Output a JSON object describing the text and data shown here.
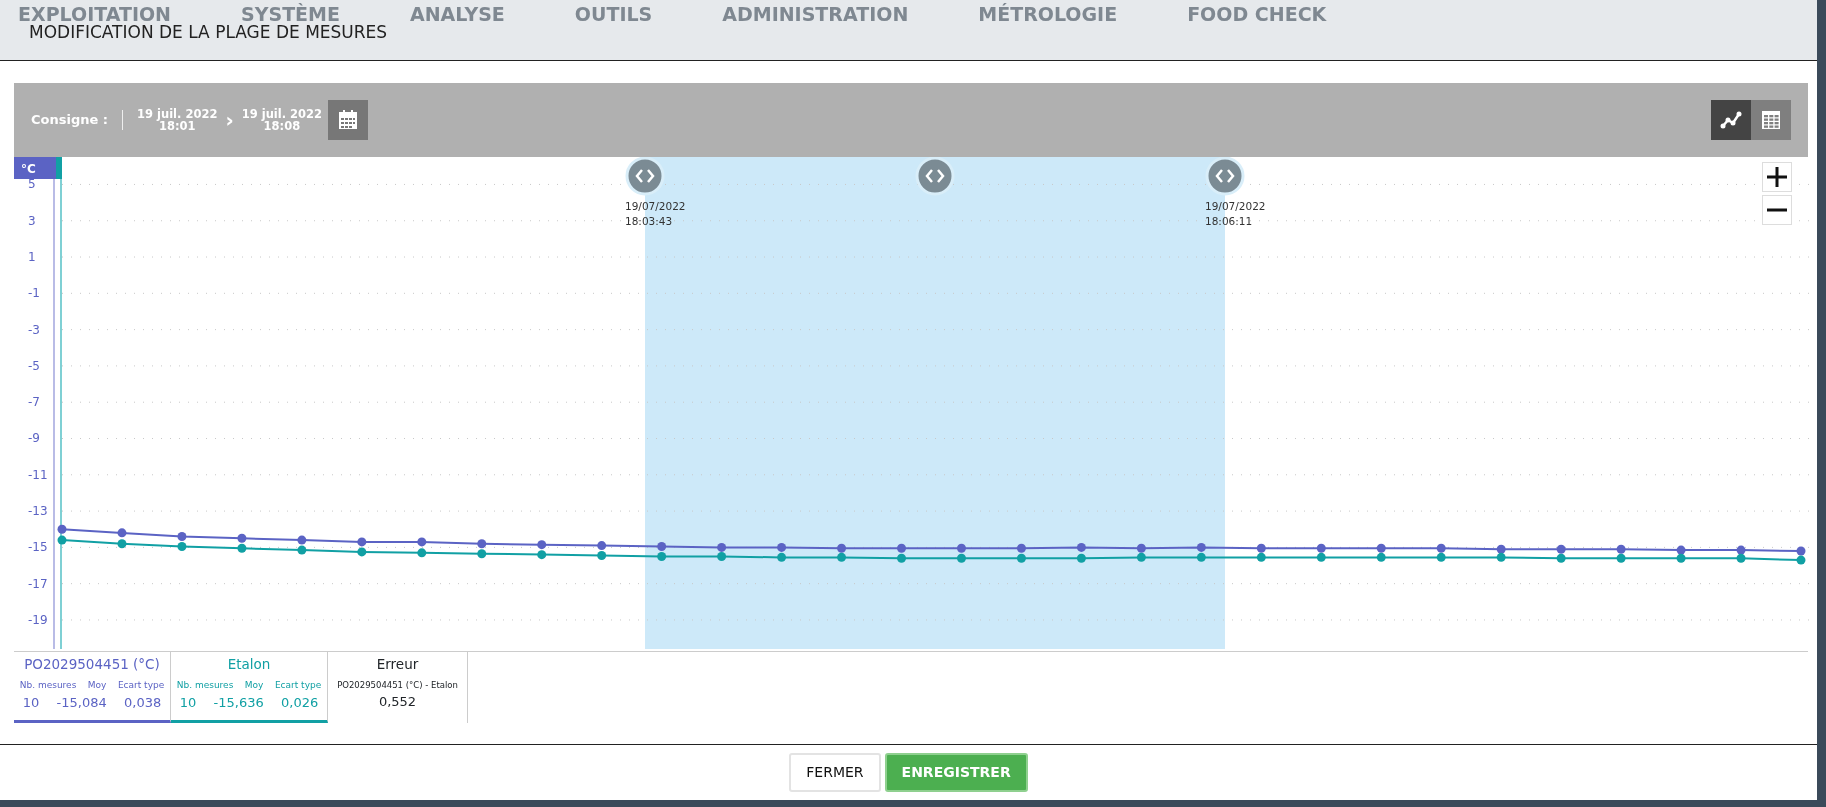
{
  "background_nav": {
    "items": [
      "EXPLOITATION",
      "SYSTÈME",
      "ANALYSE",
      "OUTILS",
      "ADMINISTRATION",
      "MÉTROLOGIE",
      "FOOD CHECK"
    ]
  },
  "modal": {
    "title": "MODIFICATION DE LA PLAGE DE MESURES"
  },
  "toolbar": {
    "label": "Consigne :",
    "from": {
      "date": "19 juil. 2022",
      "time": "18:01"
    },
    "separator": "›",
    "to": {
      "date": "19 juil. 2022",
      "time": "18:08"
    },
    "views": [
      {
        "kind": "chart",
        "selected": true
      },
      {
        "kind": "table",
        "selected": false
      }
    ]
  },
  "chart": {
    "unit": "°C",
    "selection": {
      "start": {
        "date": "19/07/2022",
        "time": "18:03:43"
      },
      "end": {
        "date": "19/07/2022",
        "time": "18:06:11"
      }
    },
    "chart_data": {
      "type": "line",
      "grid": true,
      "ylim": [
        -20.6,
        5.3
      ],
      "yticks": [
        5,
        3,
        1,
        -1,
        -3,
        -5,
        -7,
        -9,
        -11,
        -13,
        -15,
        -17,
        -19
      ],
      "series": [
        {
          "name": "PO2029504451 (°C)",
          "color": "#5b63c4",
          "marker": "circle",
          "values": [
            -14.0,
            -14.2,
            -14.4,
            -14.5,
            -14.6,
            -14.7,
            -14.7,
            -14.8,
            -14.85,
            -14.9,
            -14.95,
            -15.0,
            -15.0,
            -15.05,
            -15.05,
            -15.05,
            -15.05,
            -15.0,
            -15.05,
            -15.0,
            -15.05,
            -15.05,
            -15.05,
            -15.05,
            -15.1,
            -15.1,
            -15.1,
            -15.15,
            -15.15,
            -15.2
          ]
        },
        {
          "name": "Etalon",
          "color": "#11a0a4",
          "marker": "circle",
          "values": [
            -14.6,
            -14.8,
            -14.95,
            -15.05,
            -15.15,
            -15.25,
            -15.3,
            -15.35,
            -15.4,
            -15.45,
            -15.5,
            -15.5,
            -15.55,
            -15.55,
            -15.6,
            -15.6,
            -15.6,
            -15.6,
            -15.55,
            -15.55,
            -15.55,
            -15.55,
            -15.55,
            -15.55,
            -15.55,
            -15.6,
            -15.6,
            -15.6,
            -15.6,
            -15.7
          ]
        }
      ]
    }
  },
  "legend": [
    {
      "stats": [
        {
          "label": "Nb. mesures",
          "value": "10"
        },
        {
          "label": "Moy",
          "value": "-15,084"
        },
        {
          "label": "Ecart type",
          "value": "0,038"
        }
      ]
    },
    {
      "stats": [
        {
          "label": "Nb. mesures",
          "value": "10"
        },
        {
          "label": "Moy",
          "value": "-15,636"
        },
        {
          "label": "Ecart type",
          "value": "0,026"
        }
      ]
    }
  ],
  "error": {
    "title": "Erreur",
    "label": "PO2029504451 (°C) - Etalon",
    "value": "0,552"
  },
  "buttons": [
    {
      "kind": "secondary",
      "label": "FERMER"
    },
    {
      "kind": "primary",
      "label": "ENREGISTRER"
    }
  ]
}
